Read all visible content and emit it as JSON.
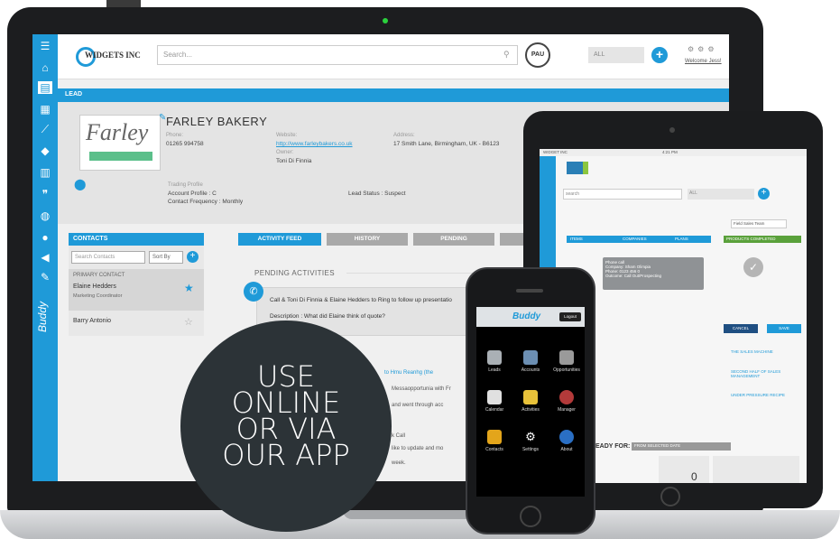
{
  "app": {
    "company_name": "WIDGETS INC",
    "search_placeholder": "Search...",
    "pau_badge": "PAU",
    "scope_select": "ALL",
    "add_symbol": "+",
    "welcome_text": "Welcome Jess!",
    "sidebar_brand": "Buddy"
  },
  "lead": {
    "section_label": "LEAD",
    "logo_text": "Farley",
    "company": "FARLEY BAKERY",
    "phone_label": "Phone:",
    "phone": "01265 994758",
    "website_label": "Website:",
    "website": "http://www.farleybakers.co.uk",
    "owner_label": "Owner:",
    "owner": "Toni Di Finnia",
    "address_label": "Address:",
    "address": "17 Smith Lane, Birmingham, UK - B6123",
    "trading_profile": "Trading Profile",
    "account_profile": "Account Profile : C",
    "contact_frequency": "Contact Frequency : Monthly",
    "lead_status": "Lead Status : Suspect"
  },
  "contacts": {
    "header": "CONTACTS",
    "search_placeholder": "Search Contacts",
    "sort_label": "Sort By",
    "primary_label": "PRIMARY CONTACT",
    "primary_name": "Elaine Hedders",
    "primary_role": "Marketing Coordinator",
    "other_name": "Barry Antonio"
  },
  "tabs": [
    "ACTIVITY FEED",
    "HISTORY",
    "PENDING",
    "LINK DOCU"
  ],
  "activity": {
    "section_label": "PENDING ACTIVITIES",
    "call_line": "Call & Toni Di Finnia & Elaine Hedders to Ring to follow up presentatio",
    "description_line": "Description : What did Elaine think of quote?",
    "snippet_1": "to Hmu Reanhg (the",
    "snippet_2": "Messaopportunia with Fr",
    "snippet_3": "and went through acc",
    "snippet_4": "k Call",
    "snippet_5": "like to update and mo",
    "snippet_6": "week."
  },
  "tablet": {
    "status_carrier": "WIDGET INC",
    "status_time": "4:21 PM",
    "search_placeholder": "search",
    "select_all": "ALL",
    "date_placeholder": "Field Sales Team",
    "tab_items": [
      "ITEMS",
      "COMPANIES",
      "PLANS"
    ],
    "panel_header": "PRODUCTS COMPLETED",
    "popup_line1": "Phone call",
    "popup_line2": "Company: Sham Olimpia",
    "popup_line3": "Phone: 0123 456 0",
    "popup_line4": "Outcome: Call Out/Prospecting",
    "cancel_btn": "CANCEL",
    "save_btn": "SAVE",
    "links": [
      "THE SALES MACHINE",
      "SECOND HALF OF SALES MANAGEMENT",
      "UNDER PRESSURE RECIPE"
    ],
    "ready_for": "EADY FOR:",
    "ready_select": "FROM SELECTED DATE",
    "zero_value": "0"
  },
  "phone": {
    "app_name": "Buddy",
    "top_button": "Logout",
    "apps": [
      "Leads",
      "Accounts",
      "Opportunities",
      "Calendar",
      "Activities",
      "Manager",
      "Contacts",
      "Settings",
      "About"
    ]
  },
  "promo": {
    "line1": "USE",
    "line2": "ONLINE",
    "line3": "OR VIA",
    "line4": "OUR APP"
  }
}
